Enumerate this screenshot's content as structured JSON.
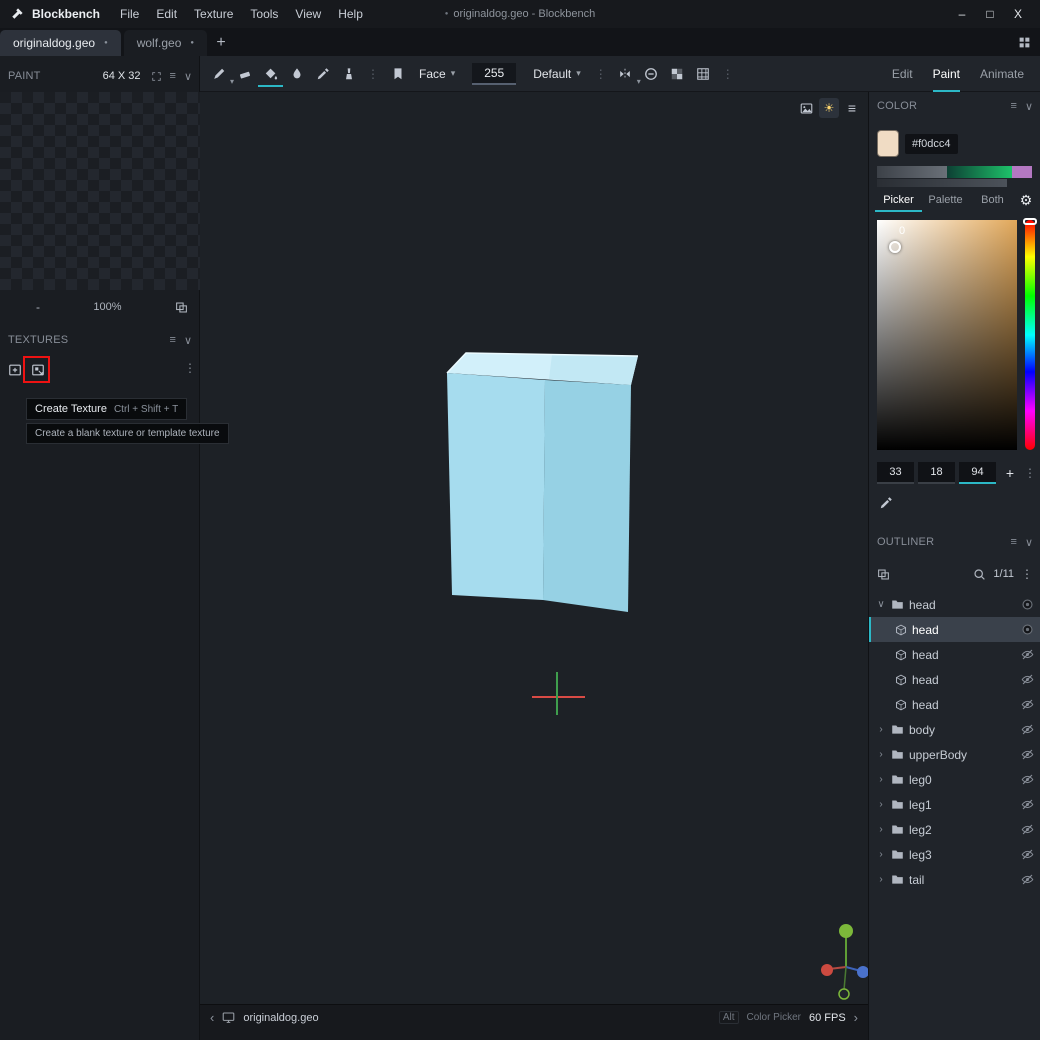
{
  "glyphs": {
    "bullet": "●",
    "caret": "▾",
    "kebab": "⋮",
    "hamburger": "≡",
    "collapse_arrow": "∨",
    "expand_arrow": "›",
    "chevron_left": "‹",
    "chevron_right": "›",
    "plus": "+",
    "sun": "☀",
    "gear": "⚙",
    "minimize": "–",
    "maximize": "□",
    "close": "X"
  },
  "colors": {
    "accent": "#2cb8c6",
    "annotation_red": "#ee1212",
    "swatch": "#f0dcc4",
    "cube_top": "#d2f0fa",
    "cube_front": "#a6dcee",
    "cube_side": "#96d1e4"
  },
  "titlebar": {
    "app_name": "Blockbench",
    "menus": [
      "File",
      "Edit",
      "Texture",
      "Tools",
      "View",
      "Help"
    ],
    "window_title": "originaldog.geo - Blockbench"
  },
  "tabs": {
    "items": [
      {
        "label": "originaldog.geo"
      },
      {
        "label": "wolf.geo"
      }
    ]
  },
  "paint_panel": {
    "title": "PAINT",
    "canvas_size": "64 X 32",
    "zoom_out": "-",
    "zoom_level": "100%"
  },
  "textures_panel": {
    "title": "TEXTURES",
    "tooltip": {
      "title": "Create Texture",
      "shortcut": "Ctrl + Shift + T",
      "description": "Create a blank texture or template texture"
    }
  },
  "toolbar": {
    "face_dropdown": "Face",
    "opacity_value": "255",
    "blend_mode": "Default"
  },
  "modes": {
    "items": [
      "Edit",
      "Paint",
      "Animate"
    ],
    "active": "Paint"
  },
  "statusbar": {
    "file_name": "originaldog.geo",
    "alt_key": "Alt",
    "alt_action": "Color Picker",
    "fps": "60 FPS"
  },
  "color_panel": {
    "title": "COLOR",
    "hex_value": "#f0dcc4",
    "tabs": [
      "Picker",
      "Palette",
      "Both"
    ],
    "active_tab": "Picker",
    "picker_value": "0",
    "channels": [
      "33",
      "18",
      "94"
    ],
    "add_palette": "+"
  },
  "outliner_panel": {
    "title": "OUTLINER",
    "search_count": "1/11",
    "rows": [
      {
        "label": "head",
        "type": "group",
        "expanded": true,
        "visible": true
      },
      {
        "label": "head",
        "type": "cube",
        "selected": true,
        "visible": true
      },
      {
        "label": "head",
        "type": "cube",
        "visible": false
      },
      {
        "label": "head",
        "type": "cube",
        "visible": false
      },
      {
        "label": "head",
        "type": "cube",
        "visible": false
      },
      {
        "label": "body",
        "type": "group",
        "visible": false
      },
      {
        "label": "upperBody",
        "type": "group",
        "visible": false
      },
      {
        "label": "leg0",
        "type": "group",
        "visible": false
      },
      {
        "label": "leg1",
        "type": "group",
        "visible": false
      },
      {
        "label": "leg2",
        "type": "group",
        "visible": false
      },
      {
        "label": "leg3",
        "type": "group",
        "visible": false
      },
      {
        "label": "tail",
        "type": "group",
        "visible": false
      }
    ]
  }
}
